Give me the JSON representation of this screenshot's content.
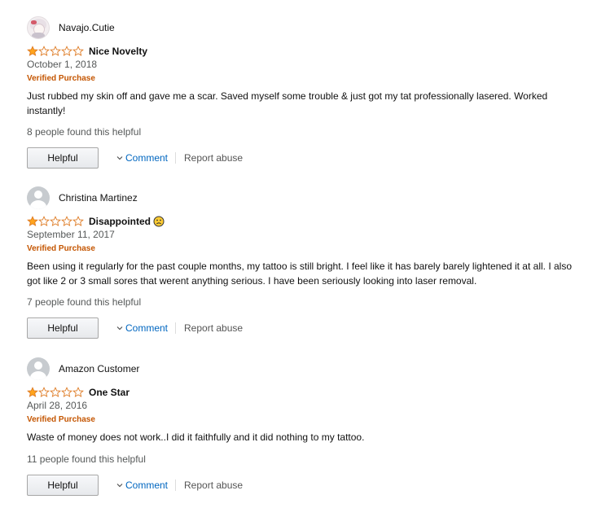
{
  "reviews": [
    {
      "name": "Navajo.Cutie",
      "avatar": "photo",
      "rating": 1,
      "title": "Nice Novelty",
      "emoji": "",
      "date": "October 1, 2018",
      "verified": "Verified Purchase",
      "body": "Just rubbed my skin off and gave me a scar. Saved myself some trouble & just got my tat professionally lasered. Worked instantly!",
      "helpful_count": "8 people found this helpful",
      "helpful_label": "Helpful",
      "comment_label": "Comment",
      "report_label": "Report abuse"
    },
    {
      "name": "Christina Martinez",
      "avatar": "default",
      "rating": 1,
      "title": "Disappointed",
      "emoji": "frowning-face",
      "date": "September 11, 2017",
      "verified": "Verified Purchase",
      "body": "Been using it regularly for the past couple months, my tattoo is still bright. I feel like it has barely barely lightened it at all. I also got like 2 or 3 small sores that werent anything serious. I have been seriously looking into laser removal.",
      "helpful_count": "7 people found this helpful",
      "helpful_label": "Helpful",
      "comment_label": "Comment",
      "report_label": "Report abuse"
    },
    {
      "name": "Amazon Customer",
      "avatar": "default",
      "rating": 1,
      "title": "One Star",
      "emoji": "",
      "date": "April 28, 2016",
      "verified": "Verified Purchase",
      "body": "Waste of money does not work..I did it faithfully and it did nothing to my tattoo.",
      "helpful_count": "11 people found this helpful",
      "helpful_label": "Helpful",
      "comment_label": "Comment",
      "report_label": "Report abuse"
    }
  ],
  "colors": {
    "star_fill": "#ffa41c",
    "star_outline": "#de7921",
    "link": "#0066c0",
    "verified": "#c45500"
  }
}
